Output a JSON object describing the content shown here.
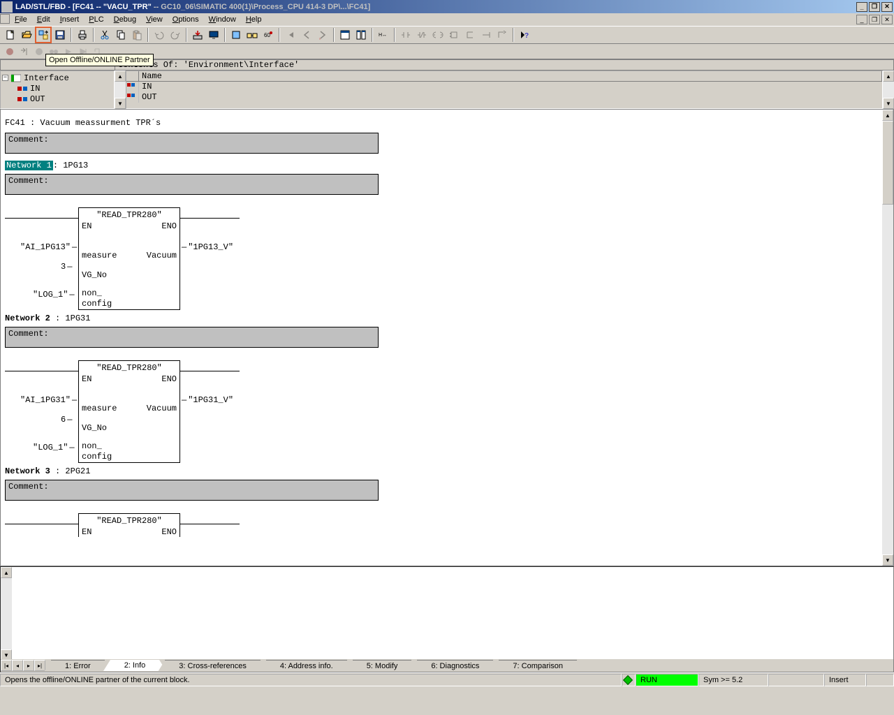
{
  "title": {
    "app": "LAD/STL/FBD",
    "sep1": " - [",
    "doc": "FC41 -- \"VACU_TPR\"",
    "sep2": " -- ",
    "path": "GC10_06\\SIMATIC 400(1)\\Process_CPU 414-3 DP\\...\\FC41]"
  },
  "menu": {
    "file": "File",
    "edit": "Edit",
    "insert": "Insert",
    "plc": "PLC",
    "debug": "Debug",
    "view": "View",
    "options": "Options",
    "window": "Window",
    "help": "Help"
  },
  "tooltip": "Open Offline/ONLINE Partner",
  "panel_header": "Contents Of: 'Environment\\Interface'",
  "tree": {
    "root": "Interface",
    "in": "IN",
    "out": "OUT"
  },
  "grid": {
    "header": "Name",
    "in": "IN",
    "out": "OUT"
  },
  "code": {
    "title": "FC41 : Vacuum meassurment TPR´s",
    "comment_label": "Comment:",
    "networks": [
      {
        "label": "Network 1",
        "desc": "1PG13",
        "selected": true,
        "block": {
          "title": "\"READ_TPR280\"",
          "en": "EN",
          "eno": "ENO",
          "left": [
            {
              "sig": "\"AI_1PG13\"",
              "port": "measure"
            },
            {
              "sig": "3",
              "port": "VG_No"
            },
            {
              "sig": "\"LOG_1\"",
              "port": "non_\nconfig"
            }
          ],
          "right": [
            {
              "port": "Vacuum",
              "sig": "\"1PG13_V\""
            }
          ]
        }
      },
      {
        "label": "Network 2",
        "desc": "1PG31",
        "selected": false,
        "block": {
          "title": "\"READ_TPR280\"",
          "en": "EN",
          "eno": "ENO",
          "left": [
            {
              "sig": "\"AI_1PG31\"",
              "port": "measure"
            },
            {
              "sig": "6",
              "port": "VG_No"
            },
            {
              "sig": "\"LOG_1\"",
              "port": "non_\nconfig"
            }
          ],
          "right": [
            {
              "port": "Vacuum",
              "sig": "\"1PG31_V\""
            }
          ]
        }
      },
      {
        "label": "Network 3",
        "desc": "2PG21",
        "selected": false,
        "block": {
          "title": "\"READ_TPR280\"",
          "en": "EN",
          "eno": "ENO"
        }
      }
    ]
  },
  "tabs": {
    "t1": "1: Error",
    "t2": "2: Info",
    "t3": "3: Cross-references",
    "t4": "4: Address info.",
    "t5": "5: Modify",
    "t6": "6: Diagnostics",
    "t7": "7: Comparison"
  },
  "status": {
    "hint": "Opens the offline/ONLINE partner of the current block.",
    "run": "RUN",
    "sym": "Sym >= 5.2",
    "insert": "Insert"
  }
}
